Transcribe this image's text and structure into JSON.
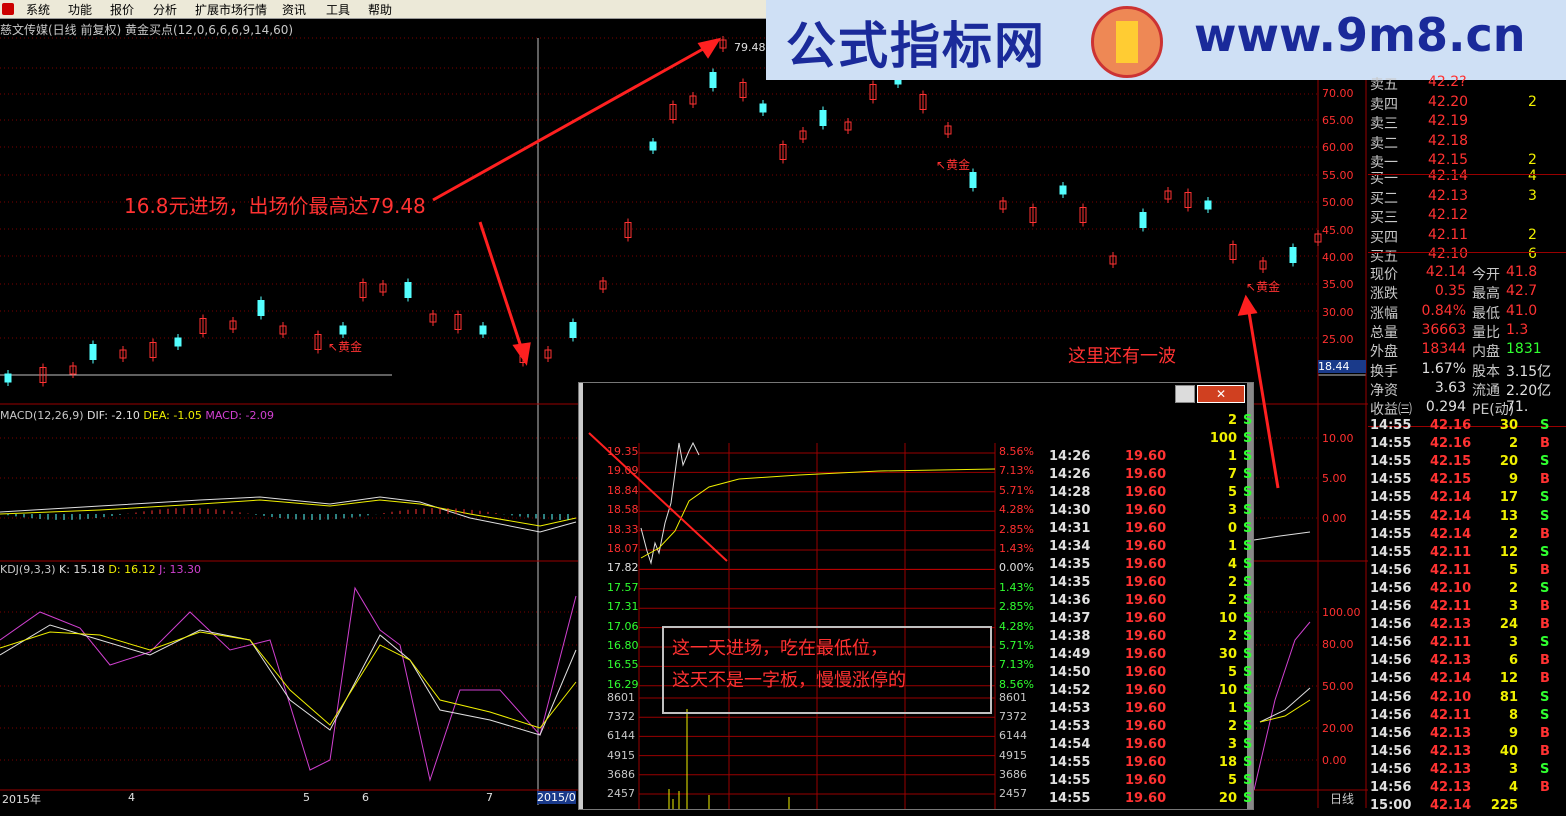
{
  "menu": [
    "系统",
    "功能",
    "报价",
    "分析",
    "扩展市场行情",
    "资讯",
    "工具",
    "帮助"
  ],
  "info_line": "慈文传媒(日线 前复权) 黄金买点(12,0,6,6,6,9,14,60)",
  "banner": {
    "site_name": "公式指标网",
    "url": "www.9m8.cn"
  },
  "chart": {
    "peak_label": "79.48",
    "golden_label": "黄金",
    "current_price_tag": "18.44",
    "right_axis": [
      "70.00",
      "65.00",
      "60.00",
      "55.00",
      "50.00",
      "45.00",
      "40.00",
      "35.00",
      "30.00",
      "25.00"
    ],
    "macd_label": "MACD(12,26,9)",
    "macd_dif": "DIF: -2.10",
    "macd_dea": "DEA: -1.05",
    "macd_macd": "MACD: -2.09",
    "macd_axis": [
      "10.00",
      "5.00",
      "0.00"
    ],
    "kdj_label": "KDJ(9,3,3)",
    "kdj_k": "K: 15.18",
    "kdj_d": "D: 16.12",
    "kdj_j": "J: 13.30",
    "kdj_axis": [
      "100.00",
      "80.00",
      "50.00",
      "20.00",
      "0.00"
    ],
    "x_labels": [
      "2015年",
      "4",
      "5",
      "6",
      "7",
      "2015/0"
    ],
    "period_label": "日线"
  },
  "annotations": {
    "entry_exit": "16.8元进场，出场价最高达79.48",
    "another_wave": "这里还有一波",
    "box_line1": "这一天进场，吃在最低位，",
    "box_line2": "这天不是一字板，慢慢涨停的"
  },
  "quote": {
    "asks": [
      [
        "卖五",
        "42.2?",
        ""
      ],
      [
        "卖四",
        "42.20",
        "2"
      ],
      [
        "卖三",
        "42.19",
        ""
      ],
      [
        "卖二",
        "42.18",
        ""
      ],
      [
        "卖一",
        "42.15",
        "2"
      ]
    ],
    "bids": [
      [
        "买一",
        "42.14",
        "4"
      ],
      [
        "买二",
        "42.13",
        "3"
      ],
      [
        "买三",
        "42.12",
        ""
      ],
      [
        "买四",
        "42.11",
        "2"
      ],
      [
        "买五",
        "42.10",
        "6"
      ]
    ],
    "stats": [
      [
        "现价",
        "42.14",
        "今开",
        "41.8"
      ],
      [
        "涨跌",
        "0.35",
        "最高",
        "42.7"
      ],
      [
        "涨幅",
        "0.84%",
        "最低",
        "41.0"
      ],
      [
        "总量",
        "36663",
        "量比",
        "1.3"
      ],
      [
        "外盘",
        "18344",
        "内盘",
        "1831"
      ],
      [
        "换手",
        "1.67%",
        "股本",
        "3.15亿"
      ],
      [
        "净资",
        "3.63",
        "流通",
        "2.20亿"
      ],
      [
        "收益㈢",
        "0.294",
        "PE(动)",
        "71."
      ]
    ]
  },
  "ticks": [
    [
      "14:55",
      "42.16",
      "30",
      "S"
    ],
    [
      "14:55",
      "42.16",
      "2",
      "B"
    ],
    [
      "14:55",
      "42.15",
      "20",
      "S"
    ],
    [
      "14:55",
      "42.15",
      "9",
      "B"
    ],
    [
      "14:55",
      "42.14",
      "17",
      "S"
    ],
    [
      "14:55",
      "42.14",
      "13",
      "S"
    ],
    [
      "14:55",
      "42.14",
      "2",
      "B"
    ],
    [
      "14:55",
      "42.11",
      "12",
      "S"
    ],
    [
      "14:56",
      "42.11",
      "5",
      "B"
    ],
    [
      "14:56",
      "42.10",
      "2",
      "S"
    ],
    [
      "14:56",
      "42.11",
      "3",
      "B"
    ],
    [
      "14:56",
      "42.13",
      "24",
      "B"
    ],
    [
      "14:56",
      "42.11",
      "3",
      "S"
    ],
    [
      "14:56",
      "42.13",
      "6",
      "B"
    ],
    [
      "14:56",
      "42.14",
      "12",
      "B"
    ],
    [
      "14:56",
      "42.10",
      "81",
      "S"
    ],
    [
      "14:56",
      "42.11",
      "8",
      "S"
    ],
    [
      "14:56",
      "42.13",
      "9",
      "B"
    ],
    [
      "14:56",
      "42.13",
      "40",
      "B"
    ],
    [
      "14:56",
      "42.13",
      "3",
      "S"
    ],
    [
      "14:56",
      "42.13",
      "4",
      "B"
    ],
    [
      "15:00",
      "42.14",
      "225",
      ""
    ]
  ],
  "popup": {
    "close_label": "✕",
    "price_axis": [
      "19.35",
      "19.09",
      "18.84",
      "18.58",
      "18.33",
      "18.07",
      "17.82",
      "17.57",
      "17.31",
      "17.06",
      "16.80",
      "16.55",
      "16.29"
    ],
    "pct_axis": [
      "8.56%",
      "7.13%",
      "5.71%",
      "4.28%",
      "2.85%",
      "1.43%",
      "0.00%",
      "1.43%",
      "2.85%",
      "4.28%",
      "5.71%",
      "7.13%",
      "8.56%"
    ],
    "vol_axis": [
      "8601",
      "7372",
      "6144",
      "4915",
      "3686",
      "2457"
    ],
    "top_ticks": [
      [
        "",
        "",
        "2",
        "S"
      ],
      [
        "",
        "",
        "100",
        "S"
      ]
    ],
    "ticks": [
      [
        "14:26",
        "19.60",
        "1",
        "S"
      ],
      [
        "14:26",
        "19.60",
        "7",
        "S"
      ],
      [
        "14:28",
        "19.60",
        "5",
        "S"
      ],
      [
        "14:30",
        "19.60",
        "3",
        "S"
      ],
      [
        "14:31",
        "19.60",
        "0",
        "S"
      ],
      [
        "14:34",
        "19.60",
        "1",
        "S"
      ],
      [
        "14:35",
        "19.60",
        "4",
        "S"
      ],
      [
        "14:35",
        "19.60",
        "2",
        "S"
      ],
      [
        "14:36",
        "19.60",
        "2",
        "S"
      ],
      [
        "14:37",
        "19.60",
        "10",
        "S"
      ],
      [
        "14:38",
        "19.60",
        "2",
        "S"
      ],
      [
        "14:49",
        "19.60",
        "30",
        "S"
      ],
      [
        "14:50",
        "19.60",
        "5",
        "S"
      ],
      [
        "14:52",
        "19.60",
        "10",
        "S"
      ],
      [
        "14:53",
        "19.60",
        "1",
        "S"
      ],
      [
        "14:53",
        "19.60",
        "2",
        "S"
      ],
      [
        "14:54",
        "19.60",
        "3",
        "S"
      ],
      [
        "14:55",
        "19.60",
        "18",
        "S"
      ],
      [
        "14:55",
        "19.60",
        "5",
        "S"
      ],
      [
        "14:55",
        "19.60",
        "20",
        "S"
      ]
    ]
  },
  "colors": {
    "up": "#ff3232",
    "down": "#54ffff",
    "yellow": "#f0f000",
    "green": "#30ff30",
    "magenta": "#d040d0"
  }
}
